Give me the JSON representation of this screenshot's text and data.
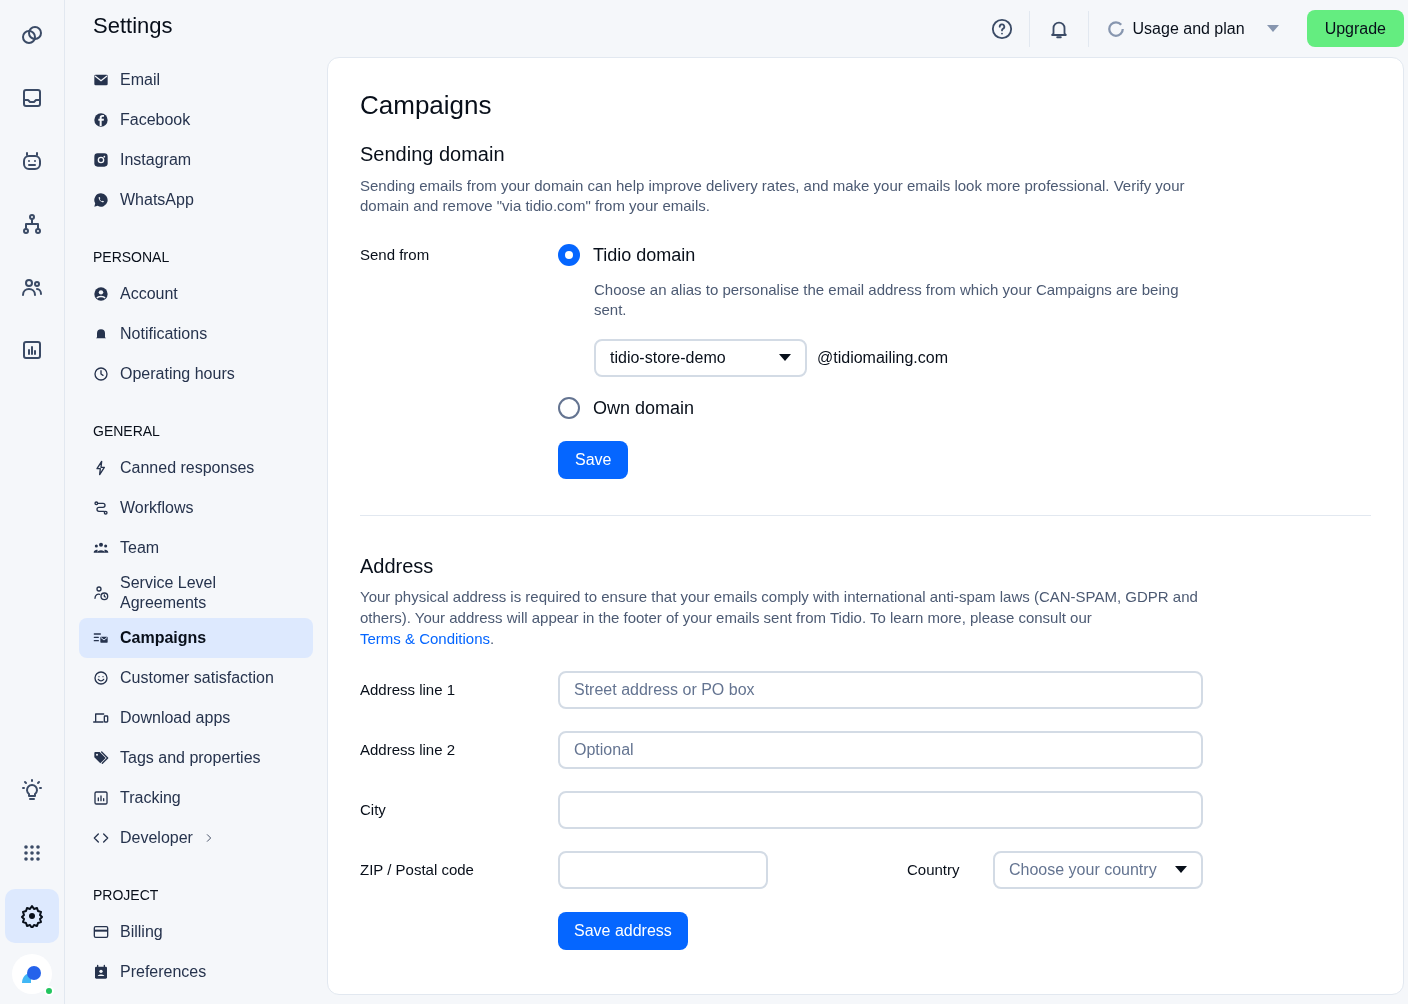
{
  "rail": {
    "top": [
      {
        "kind": "bubbles",
        "selected": false
      },
      {
        "kind": "inbox",
        "selected": false
      },
      {
        "kind": "bot",
        "selected": false
      },
      {
        "kind": "flow",
        "selected": false
      },
      {
        "kind": "users",
        "selected": false
      },
      {
        "kind": "chart",
        "selected": false
      }
    ],
    "bottom": [
      {
        "kind": "bulb",
        "selected": false
      },
      {
        "kind": "grid",
        "selected": false
      },
      {
        "kind": "gear",
        "selected": true
      }
    ],
    "profile": {
      "online": true
    }
  },
  "nav": {
    "title": "Settings",
    "sections": [
      {
        "items": [
          {
            "label": "Email",
            "kind": "mail",
            "selected": false
          },
          {
            "label": "Facebook",
            "kind": "fb",
            "selected": false
          },
          {
            "label": "Instagram",
            "kind": "ig",
            "selected": false
          },
          {
            "label": "WhatsApp",
            "kind": "wa",
            "selected": false
          }
        ]
      },
      {
        "heading": "PERSONAL",
        "items": [
          {
            "label": "Account",
            "kind": "user",
            "selected": false
          },
          {
            "label": "Notifications",
            "kind": "bell",
            "selected": false
          },
          {
            "label": "Operating hours",
            "kind": "clock",
            "selected": false
          }
        ]
      },
      {
        "heading": "GENERAL",
        "items": [
          {
            "label": "Canned responses",
            "kind": "bolt",
            "selected": false
          },
          {
            "label": "Workflows",
            "kind": "route",
            "selected": false
          },
          {
            "label": "Team",
            "kind": "team",
            "selected": false
          },
          {
            "label": "Service Level Agreements",
            "kind": "sla",
            "selected": false
          },
          {
            "label": "Campaigns",
            "kind": "campaign",
            "selected": true
          },
          {
            "label": "Customer satisfaction",
            "kind": "smile",
            "selected": false
          },
          {
            "label": "Download apps",
            "kind": "devices",
            "selected": false
          },
          {
            "label": "Tags and properties",
            "kind": "tag",
            "selected": false
          },
          {
            "label": "Tracking",
            "kind": "chart",
            "selected": false
          },
          {
            "label": "Developer",
            "kind": "code",
            "selected": false,
            "submenu": true
          }
        ]
      },
      {
        "heading": "PROJECT",
        "items": [
          {
            "label": "Billing",
            "kind": "card",
            "selected": false
          },
          {
            "label": "Preferences",
            "kind": "pref",
            "selected": false
          }
        ]
      }
    ]
  },
  "header": {
    "usage": "Usage and plan",
    "upgrade": "Upgrade"
  },
  "page": {
    "title": "Campaigns",
    "sending_domain": {
      "heading": "Sending domain",
      "description": "Sending emails from your domain can help improve delivery rates, and make your emails look more professional. Verify your domain and remove \"via tidio.com\" from your emails.",
      "send_from": "Send from",
      "options": [
        {
          "label": "Tidio domain",
          "selected": true,
          "hint": "Choose an alias to personalise the email address from which your Campaigns are being sent.",
          "alias": "tidio-store-demo",
          "suffix": "@tidiomailing.com"
        },
        {
          "label": "Own domain",
          "selected": false
        }
      ],
      "save": "Save"
    },
    "address": {
      "heading": "Address",
      "description": "Your physical address is required to ensure that your emails comply with international anti-spam laws (CAN-SPAM, GDPR and others). Your address will appear in the footer of your emails sent from Tidio. To learn more, please consult our",
      "link": "Terms & Conditions",
      "after_link": ".",
      "fields": [
        {
          "label": "Address line 1",
          "placeholder": "Street address or PO box"
        },
        {
          "label": "Address line 2",
          "placeholder": "Optional"
        },
        {
          "label": "City"
        }
      ],
      "zip_label": "ZIP / Postal code",
      "country_label": "Country",
      "country_placeholder": "Choose your country",
      "save": "Save address"
    }
  }
}
